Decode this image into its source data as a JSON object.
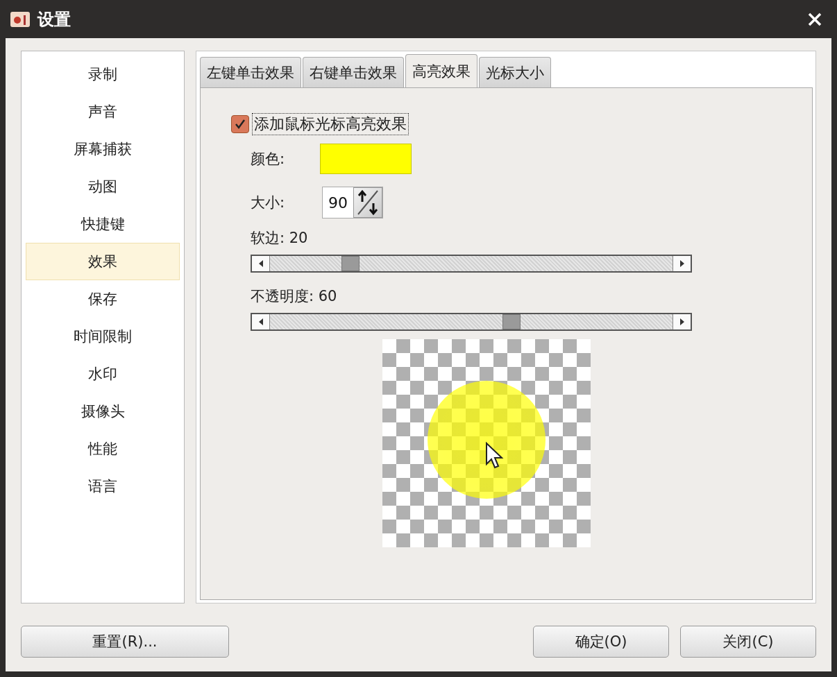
{
  "window": {
    "title": "设置"
  },
  "sidebar": {
    "items": [
      {
        "label": "录制",
        "selected": false
      },
      {
        "label": "声音",
        "selected": false
      },
      {
        "label": "屏幕捕获",
        "selected": false
      },
      {
        "label": "动图",
        "selected": false
      },
      {
        "label": "快捷键",
        "selected": false
      },
      {
        "label": "效果",
        "selected": true
      },
      {
        "label": "保存",
        "selected": false
      },
      {
        "label": "时间限制",
        "selected": false
      },
      {
        "label": "水印",
        "selected": false
      },
      {
        "label": "摄像头",
        "selected": false
      },
      {
        "label": "性能",
        "selected": false
      },
      {
        "label": "语言",
        "selected": false
      }
    ]
  },
  "tabs": [
    {
      "label": "左键单击效果",
      "selected": false
    },
    {
      "label": "右键单击效果",
      "selected": false
    },
    {
      "label": "高亮效果",
      "selected": true
    },
    {
      "label": "光标大小",
      "selected": false
    }
  ],
  "highlight": {
    "enable": {
      "label": "添加鼠标光标高亮效果",
      "checked": true
    },
    "color": {
      "label": "颜色:",
      "color": "#ffff00"
    },
    "size": {
      "label": "大小:",
      "value": "90"
    },
    "sliders": [
      {
        "reading": "软边: 20",
        "level": 0.2
      },
      {
        "reading": "不透明度: 60",
        "level": 0.6
      }
    ]
  },
  "buttons": {
    "reset": "重置(R)...",
    "ok": "确定(O)",
    "close": "关闭(C)"
  }
}
